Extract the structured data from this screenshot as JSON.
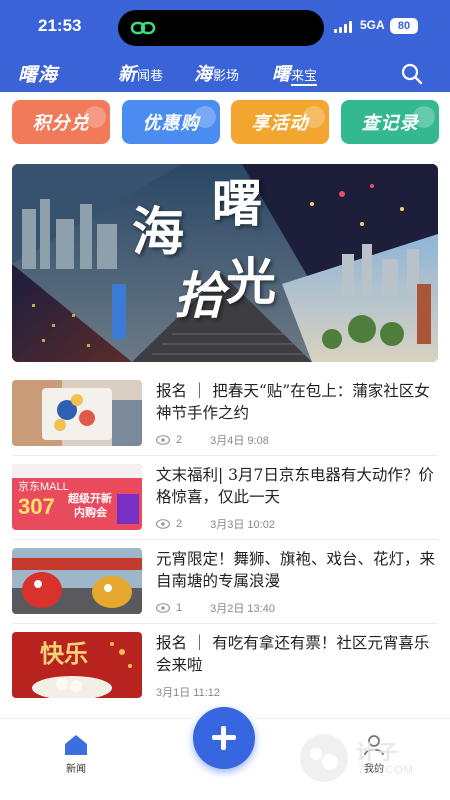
{
  "status": {
    "time": "21:53",
    "network": "5GA",
    "battery": "80"
  },
  "nav": {
    "brand": "曙海",
    "tabs": [
      {
        "main": "新",
        "sub": "闻巷"
      },
      {
        "main": "海",
        "sub": "影场"
      },
      {
        "main": "曙",
        "sub": "来宝"
      }
    ]
  },
  "quick_actions": [
    {
      "label": "积分兑",
      "color": "#f07a5a"
    },
    {
      "label": "优惠购",
      "color": "#4a8cf0"
    },
    {
      "label": "享活动",
      "color": "#f2a630"
    },
    {
      "label": "查记录",
      "color": "#34b890"
    }
  ],
  "banner": {
    "title_a": "海",
    "title_b": "曙",
    "title_c": "拾",
    "title_d": "光"
  },
  "articles": [
    {
      "title": "报名 ｜ 把春天“贴”在包上：蒲家社区女神节手作之约",
      "views": "2",
      "date": "3月4日 9:08"
    },
    {
      "title": "文末福利| 3月7日京东电器有大动作？价格惊喜，仅此一天",
      "views": "2",
      "date": "3月3日 10:02"
    },
    {
      "title": "元宵限定！舞狮、旗袍、戏台、花灯，来自南塘的专属浪漫",
      "views": "1",
      "date": "3月2日 13:40"
    },
    {
      "title": "报名 ｜ 有吃有拿还有票！社区元宵喜乐会来啦",
      "views": "",
      "date": "3月1日 11:12"
    }
  ],
  "thumbs": {
    "jd_brand": "京东MALL",
    "jd_promo": "307",
    "jd_promo_sub": "超级开新",
    "jd_promo_sub2": "内购会",
    "lantern_text": "快乐"
  },
  "bottom": {
    "news_label": "新闻",
    "mine_label": "我的"
  },
  "watermark": {
    "text": "计子",
    "url": "7YZ.COM"
  },
  "colors": {
    "primary": "#3b63d8",
    "fab": "#3767e0"
  }
}
